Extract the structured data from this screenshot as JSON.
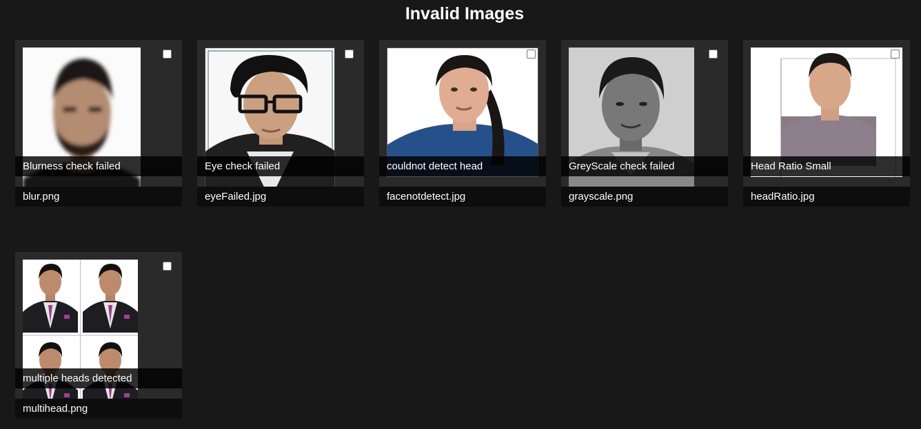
{
  "page": {
    "title": "Invalid Images"
  },
  "cards": [
    {
      "error": "Blurness check failed",
      "filename": "blur.png",
      "selected": false
    },
    {
      "error": "Eye check failed",
      "filename": "eyeFailed.jpg",
      "selected": false
    },
    {
      "error": "couldnot detect head",
      "filename": "facenotdetect.jpg",
      "selected": false
    },
    {
      "error": "GreyScale check failed",
      "filename": "grayscale.png",
      "selected": false
    },
    {
      "error": "Head Ratio Small",
      "filename": "headRatio.jpg",
      "selected": false
    },
    {
      "error": "multiple heads detected",
      "filename": "multihead.png",
      "selected": false
    }
  ]
}
